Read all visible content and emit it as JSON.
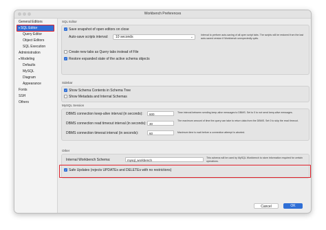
{
  "window": {
    "title": "Workbench Preferences"
  },
  "sidebar": {
    "items": [
      {
        "label": "General Editors"
      },
      {
        "label": "SQL Editor"
      },
      {
        "label": "Query Editor"
      },
      {
        "label": "Object Editors"
      },
      {
        "label": "SQL Execution"
      },
      {
        "label": "Administration"
      },
      {
        "label": "Modeling"
      },
      {
        "label": "Defaults"
      },
      {
        "label": "MySQL"
      },
      {
        "label": "Diagram"
      },
      {
        "label": "Appearance"
      },
      {
        "label": "Fonts"
      },
      {
        "label": "SSH"
      },
      {
        "label": "Others"
      }
    ]
  },
  "sql_editor": {
    "group_label": "SQL Editor",
    "save_snapshot": {
      "label": "Save snapshot of open editors on close",
      "checked": true
    },
    "autosave": {
      "label": "Auto-save scripts interval:",
      "value": "10 seconds",
      "help": "Interval to perform auto-saving of all open script tabs. The scripts will be restored from the last auto-saved version if Workbench unexpectedly quits."
    },
    "create_tabs": {
      "label": "Create new tabs as Query tabs instead of File",
      "checked": false
    },
    "restore_expanded": {
      "label": "Restore expanded state of the active schema objects",
      "checked": true
    }
  },
  "sidebar_section": {
    "group_label": "Sidebar",
    "show_schema_contents": {
      "label": "Show Schema Contents in Schema Tree",
      "checked": true
    },
    "show_metadata": {
      "label": "Show Metadata and Internal Schemas",
      "checked": false
    }
  },
  "mysql_session": {
    "group_label": "MySQL Session",
    "keepalive": {
      "label": "DBMS connection keep-alive interval (in seconds):",
      "value": "600",
      "help": "Time interval between sending keep-alive messages to DBMS. Set to 0 to not send keep-alive messages."
    },
    "read_timeout": {
      "label": "DBMS connection read timeout interval (in seconds):",
      "value": "30",
      "help": "The maximum amount of time the query can take to return data from the DBMS. Set 0 to skip the read timeout."
    },
    "connect_timeout": {
      "label": "DBMS connection timeout interval (in seconds):",
      "value": "60",
      "help": "Maximum time to wait before a connection attempt is aborted."
    }
  },
  "other": {
    "group_label": "Other",
    "internal_schema": {
      "label": "Internal Workbench Schema:",
      "value": "mysql_workbench",
      "help": "This schema will be used by MySQL Workbench to store information required for certain operations."
    },
    "safe_updates": {
      "label": "Safe Updates (rejects UPDATEs and DELETEs with no restrictions)",
      "checked": true
    }
  },
  "footer": {
    "cancel_label": "Cancel",
    "ok_label": "OK"
  },
  "colors": {
    "accent": "#2f6fd6",
    "highlight": "#e0202a"
  },
  "icons": {
    "checkmark": "checkmark-icon",
    "chevron": "chevron-updown-icon",
    "disclosure": "disclosure-triangle-icon"
  }
}
